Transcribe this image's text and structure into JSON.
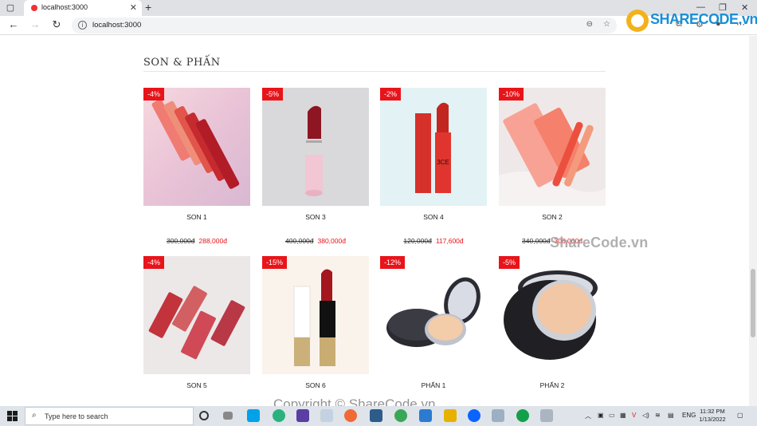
{
  "browser": {
    "tab_title": "localhost:3000",
    "url": "localhost:3000"
  },
  "brand_logo": "SHARECODE.vn",
  "section": {
    "title": "SON & PHẤN"
  },
  "products": [
    {
      "name": "SON 1",
      "discount": "-4%",
      "old_price": "300,000đ",
      "new_price": "288,000đ"
    },
    {
      "name": "SON 3",
      "discount": "-5%",
      "old_price": "400,000đ",
      "new_price": "380,000đ"
    },
    {
      "name": "SON 4",
      "discount": "-2%",
      "old_price": "120,000đ",
      "new_price": "117,600đ"
    },
    {
      "name": "SON 2",
      "discount": "-10%",
      "old_price": "340,000đ",
      "new_price": "306,000đ"
    },
    {
      "name": "SON 5",
      "discount": "-4%"
    },
    {
      "name": "SON 6",
      "discount": "-15%"
    },
    {
      "name": "PHẤN 1",
      "discount": "-12%"
    },
    {
      "name": "PHẤN 2",
      "discount": "-5%"
    }
  ],
  "watermark": "ShareCode.vn",
  "copyright": "Copyright © ShareCode.vn",
  "taskbar": {
    "search_placeholder": "Type here to search",
    "language": "ENG",
    "time": "11:32 PM",
    "date": "1/13/2022"
  },
  "colors": {
    "accent_red": "#e8141a",
    "brand_blue": "#1a8fd6",
    "brand_orange": "#f08a1c"
  }
}
